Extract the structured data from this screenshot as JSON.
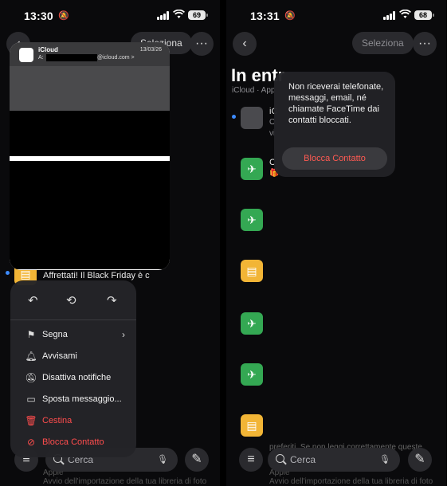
{
  "left": {
    "status": {
      "time": "13:30",
      "battery": "69"
    },
    "header": {
      "select_label": "Seleziona"
    },
    "preview": {
      "sender": "iCloud",
      "to_prefix": "A:",
      "to_domain": "@icloud.com >",
      "date": "13/03/26"
    },
    "background_rows": [
      {
        "text": "Affrettati! Il Black Friday è c",
        "sub": ""
      }
    ],
    "context_menu": {
      "items": [
        {
          "label": "Segna",
          "icon": "flag-icon",
          "has_submenu": true
        },
        {
          "label": "Avvisami",
          "icon": "bell-icon"
        },
        {
          "label": "Disattiva notifiche",
          "icon": "bell-slash-icon"
        },
        {
          "label": "Sposta messaggio...",
          "icon": "folder-icon"
        },
        {
          "label": "Cestina",
          "icon": "trash-icon",
          "destructive": true
        },
        {
          "label": "Blocca Contatto",
          "icon": "block-icon",
          "destructive": true
        }
      ]
    },
    "search": {
      "placeholder": "Cerca"
    },
    "footer_text": "Apple",
    "footer_sub": "Avvio dell'importazione della tua libreria di foto"
  },
  "right": {
    "status": {
      "time": "13:31",
      "battery": "68"
    },
    "header": {
      "select_label": "Seleziona"
    },
    "title": "In entr",
    "subtitle": "iCloud · App",
    "rows": [
      {
        "icon": "apple-icon",
        "color": "gray",
        "line1": "iC",
        "line2": "O",
        "line3": "vi"
      },
      {
        "icon": "plane-icon",
        "color": "green",
        "line1": "C",
        "line2": "🎁"
      },
      {
        "icon": "plane-icon",
        "color": "green"
      },
      {
        "icon": "bag-icon",
        "color": "yellow"
      },
      {
        "icon": "plane-icon",
        "color": "green"
      },
      {
        "icon": "plane-icon",
        "color": "green"
      },
      {
        "icon": "bag-icon",
        "color": "yellow"
      }
    ],
    "popover": {
      "message": "Non riceverai telefonate, messaggi, email, né chiamate FaceTime dai contatti bloccati.",
      "button": "Blocca Contatto"
    },
    "bottom_hint": "preferiti. Se non leggi correttamente queste",
    "search": {
      "placeholder": "Cerca"
    },
    "footer_text": "Apple",
    "footer_sub": "Avvio dell'importazione della tua libreria di foto"
  },
  "colors": {
    "accent": "#3d8bfd",
    "destructive": "#ff4d4d",
    "green": "#34a853",
    "yellow": "#f2b536"
  }
}
